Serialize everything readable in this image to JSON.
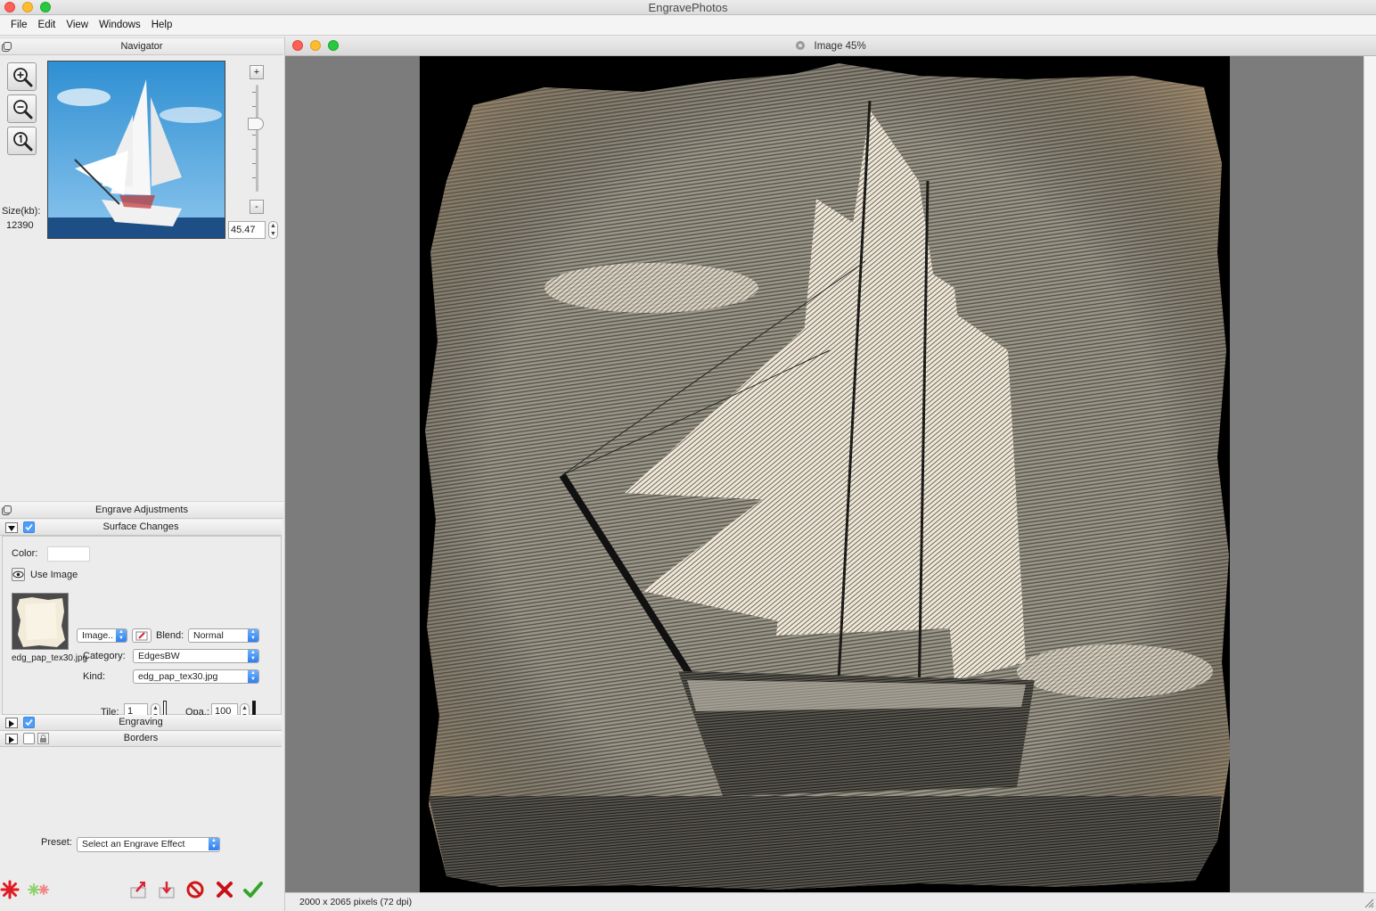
{
  "app": {
    "title": "EngravePhotos"
  },
  "menu": {
    "items": [
      "File",
      "Edit",
      "View",
      "Windows",
      "Help"
    ]
  },
  "navigator": {
    "title": "Navigator",
    "size_label": "Size(kb):",
    "size_value": "12390",
    "zoom_value": "45.47",
    "zoom_plus": "+",
    "zoom_minus": "-",
    "zoom_level": 0.63
  },
  "adjustments": {
    "title": "Engrave Adjustments",
    "surface": {
      "title": "Surface Changes",
      "enabled": true,
      "color_label": "Color:",
      "color_value": "#ffffff",
      "use_image_label": "Use Image",
      "image_select": "Image..",
      "blend_label": "Blend:",
      "blend_value": "Normal",
      "category_label": "Category:",
      "category_value": "EdgesBW",
      "kind_label": "Kind:",
      "kind_value": "edg_pap_tex30.jpg",
      "texture_name": "edg_pap_tex30.jpg",
      "tile_label": "Tile:",
      "tile_value": "1",
      "opa_label": "Opa.:",
      "opa_value": "100"
    },
    "engraving": {
      "title": "Engraving",
      "enabled": true
    },
    "borders": {
      "title": "Borders",
      "enabled": false
    }
  },
  "preset": {
    "label": "Preset:",
    "value": "Select an Engrave Effect"
  },
  "image_window": {
    "title": "Image 45%",
    "status": "2000 x 2065 pixels (72 dpi)"
  },
  "colors": {
    "accent": "#4d9ef8",
    "paper": "#d8c4a0",
    "canvas_bg": "#7c7c7c"
  }
}
